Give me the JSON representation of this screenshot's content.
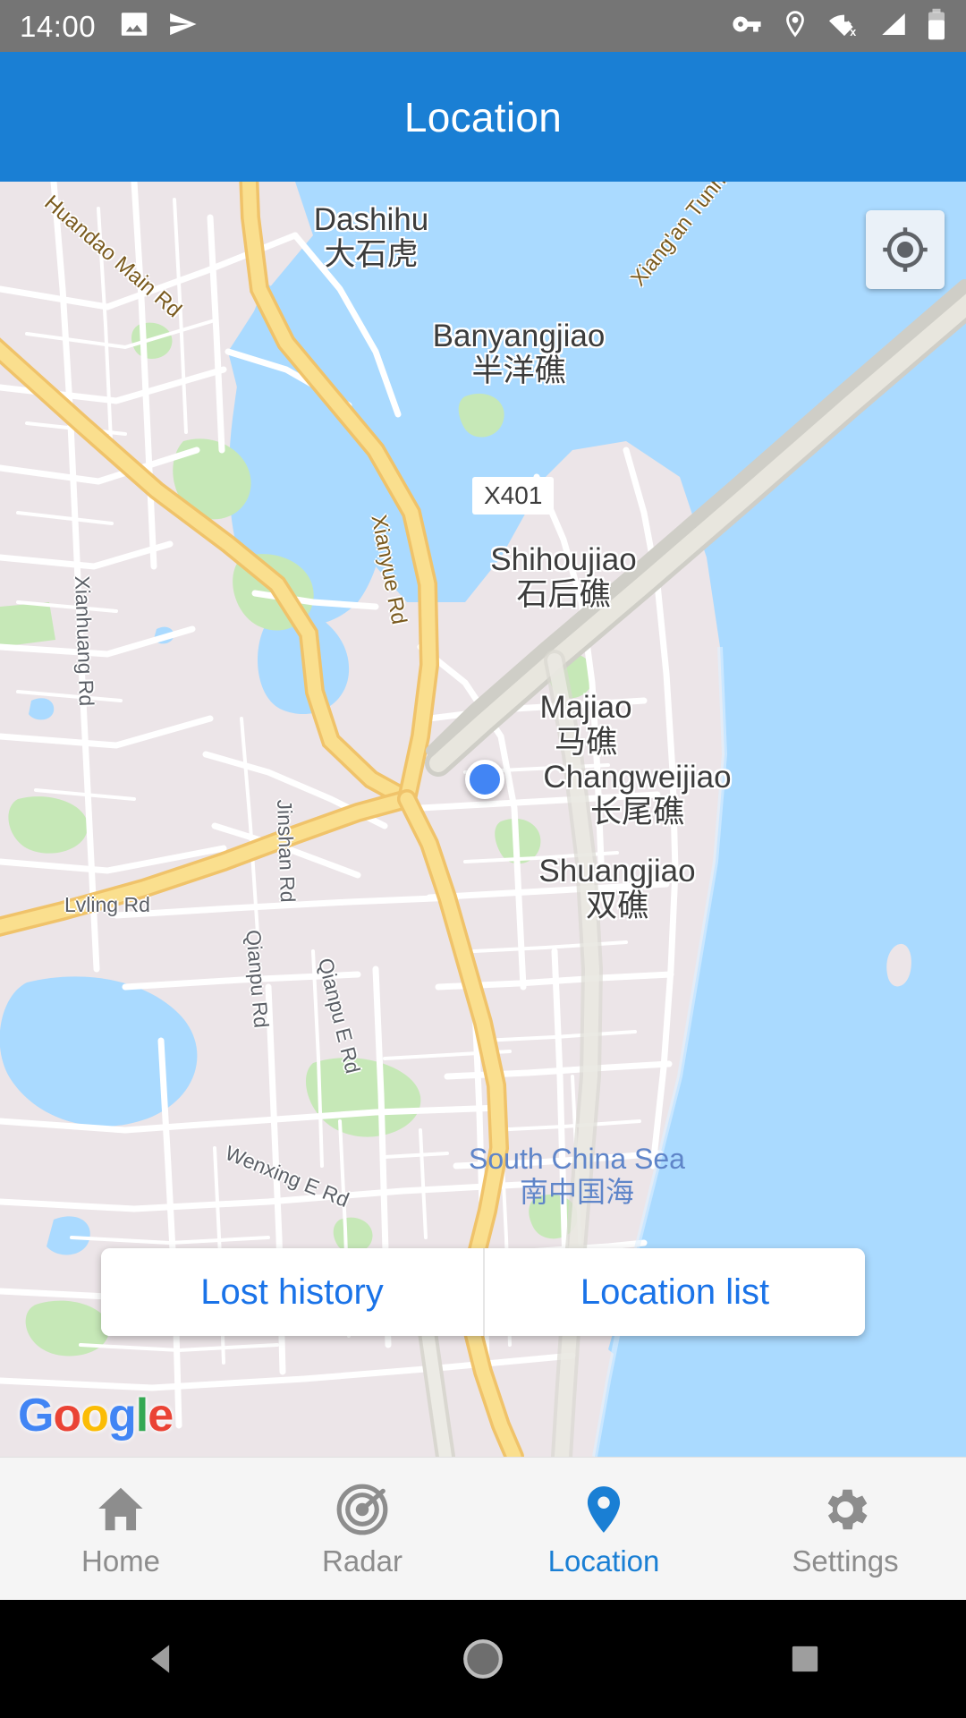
{
  "status_bar": {
    "time": "14:00",
    "left_icons": [
      "image-icon",
      "send-icon"
    ],
    "right_icons": [
      "vpn-key-icon",
      "location-pin-icon",
      "wifi-off-icon",
      "cellular-signal-icon",
      "battery-icon"
    ],
    "background_color": "#757575"
  },
  "app_bar": {
    "title": "Location",
    "background_color": "#1a7fd4",
    "text_color": "#ffffff"
  },
  "map": {
    "provider_logo": "Google",
    "my_location_button_icon": "my-location-crosshair-icon",
    "user_marker": {
      "label": "current-location-dot",
      "color": "#4285f4"
    },
    "water_color": "#aadaff",
    "land_color": "#ece5e8",
    "highway_color": "#fadf8e",
    "place_labels": [
      {
        "en": "Dashihu",
        "zh": "大石虎"
      },
      {
        "en": "Banyangjiao",
        "zh": "半洋礁"
      },
      {
        "en": "Shihoujiao",
        "zh": "石后礁"
      },
      {
        "en": "Majiao",
        "zh": "马礁"
      },
      {
        "en": "Changweijiao",
        "zh": "长尾礁"
      },
      {
        "en": "Shuangjiao",
        "zh": "双礁"
      }
    ],
    "sea_label": {
      "en": "South China Sea",
      "zh": "南中国海",
      "color": "#5f85c9"
    },
    "road_labels": [
      {
        "name": "Huandao Main Rd",
        "type": "major"
      },
      {
        "name": "Xiang'an Tunnel",
        "type": "major"
      },
      {
        "name": "Xianyue Rd",
        "type": "major"
      },
      {
        "name": "Xianhuang Rd",
        "type": "minor"
      },
      {
        "name": "Jinshan Rd",
        "type": "minor"
      },
      {
        "name": "Qianpu Rd",
        "type": "minor"
      },
      {
        "name": "Qianpu E Rd",
        "type": "minor"
      },
      {
        "name": "Lvling Rd",
        "type": "minor"
      },
      {
        "name": "Wenxing E Rd",
        "type": "minor"
      }
    ],
    "route_shield": "X401"
  },
  "action_bar": {
    "buttons": [
      {
        "label": "Lost history"
      },
      {
        "label": "Location list"
      }
    ],
    "text_color": "#1a73e8"
  },
  "bottom_nav": {
    "active_index": 2,
    "active_color": "#1a7fd4",
    "inactive_color": "#8d8d8d",
    "items": [
      {
        "label": "Home",
        "icon": "home-icon"
      },
      {
        "label": "Radar",
        "icon": "radar-target-icon"
      },
      {
        "label": "Location",
        "icon": "location-pin-icon"
      },
      {
        "label": "Settings",
        "icon": "gear-icon"
      }
    ]
  },
  "system_nav": {
    "buttons": [
      {
        "name": "back-button",
        "icon": "triangle-back-icon"
      },
      {
        "name": "home-button",
        "icon": "circle-home-icon"
      },
      {
        "name": "recents-button",
        "icon": "square-recents-icon"
      }
    ]
  }
}
